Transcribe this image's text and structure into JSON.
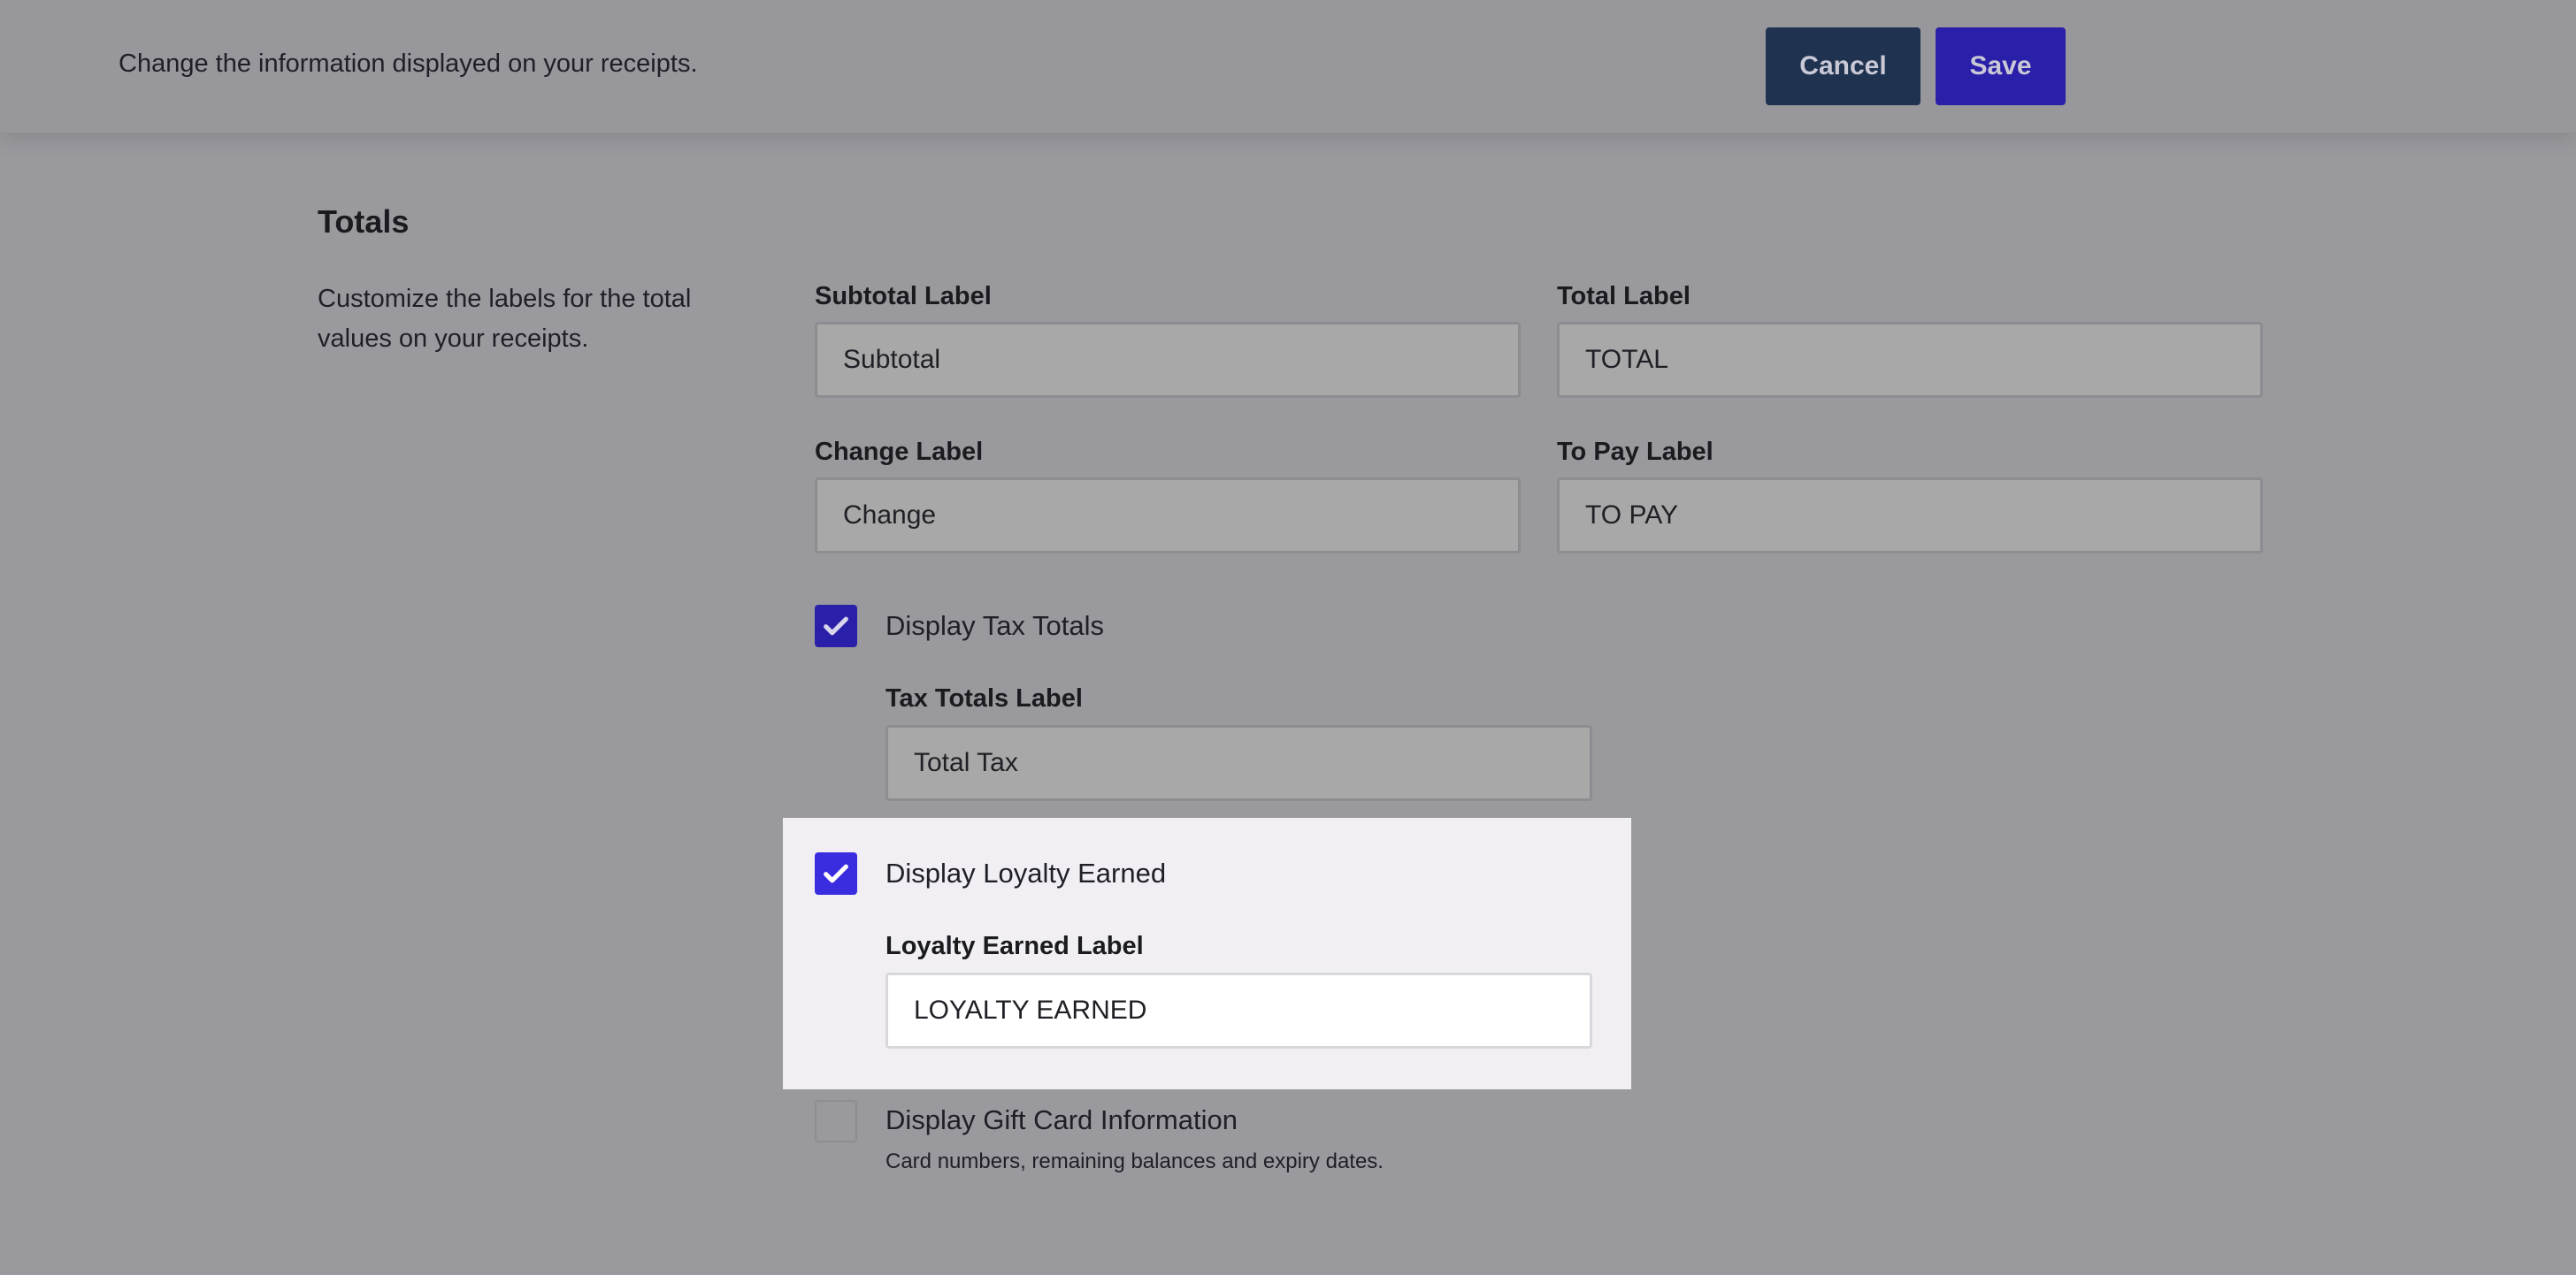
{
  "header": {
    "description": "Change the information displayed on your receipts.",
    "cancel_label": "Cancel",
    "save_label": "Save"
  },
  "totals": {
    "title": "Totals",
    "description": "Customize the labels for the total values on your receipts.",
    "fields": {
      "subtotal": {
        "label": "Subtotal Label",
        "value": "Subtotal"
      },
      "total": {
        "label": "Total Label",
        "value": "TOTAL"
      },
      "change": {
        "label": "Change Label",
        "value": "Change"
      },
      "to_pay": {
        "label": "To Pay Label",
        "value": "TO PAY"
      }
    },
    "tax_totals": {
      "checkbox_label": "Display Tax Totals",
      "checked": true,
      "field_label": "Tax Totals Label",
      "value": "Total Tax"
    },
    "loyalty_earned": {
      "checkbox_label": "Display Loyalty Earned",
      "checked": true,
      "field_label": "Loyalty Earned Label",
      "value": "LOYALTY EARNED"
    },
    "gift_card": {
      "checkbox_label": "Display Gift Card Information",
      "checked": false,
      "hint": "Card numbers, remaining balances and expiry dates."
    }
  },
  "colors": {
    "primary": "#2a1fa8",
    "cancel": "#1f3350",
    "overlay_bg": "#9a999e",
    "highlight_bg": "#f1eff3"
  }
}
